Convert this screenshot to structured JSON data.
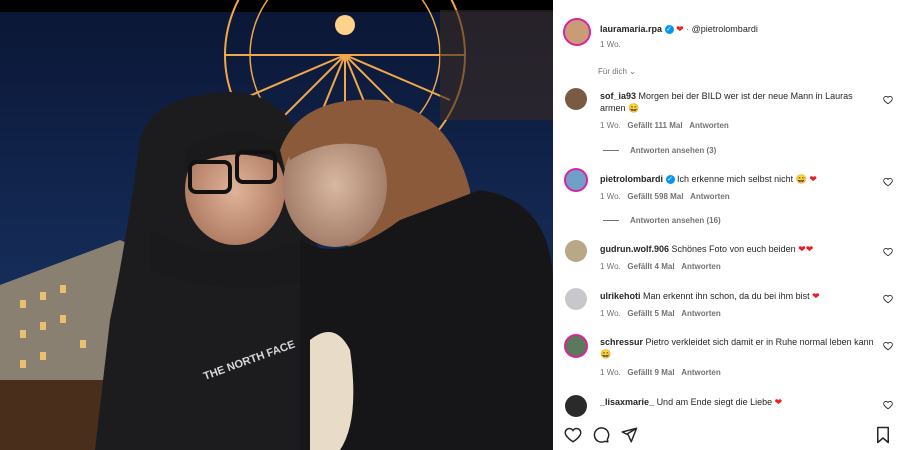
{
  "post": {
    "author": "lauramaria.rpa",
    "tag": "@pietrolombardi",
    "age": "1 Wo.",
    "for_you": "Für dich"
  },
  "photo": {
    "jacket_logo": "THE NORTH FACE"
  },
  "comments": [
    {
      "user": "sof_ia93",
      "text": "Morgen bei der BILD wer ist der neue Mann in Lauras armen 😄",
      "age": "1 Wo.",
      "likes": "Gefällt 111 Mal",
      "reply": "Antworten",
      "view_replies": "Antworten ansehen (3)"
    },
    {
      "user": "pietrolombardi",
      "verified": true,
      "text": "Ich erkenne mich selbst nicht 😄",
      "age": "1 Wo.",
      "likes": "Gefällt 598 Mal",
      "reply": "Antworten",
      "view_replies": "Antworten ansehen (16)"
    },
    {
      "user": "gudrun.wolf.906",
      "text": "Schönes Foto von euch beiden",
      "age": "1 Wo.",
      "likes": "Gefällt 4 Mal",
      "reply": "Antworten"
    },
    {
      "user": "ulrikehoti",
      "text": "Man erkennt ihn schon, da du bei ihm bist",
      "age": "1 Wo.",
      "likes": "Gefällt 5 Mal",
      "reply": "Antworten"
    },
    {
      "user": "schressur",
      "text": "Pietro verkleidet sich damit er in Ruhe normal leben kann 😄",
      "age": "1 Wo.",
      "likes": "Gefällt 9 Mal",
      "reply": "Antworten"
    },
    {
      "user": "_lisaxmarie_",
      "text": "Und am Ende siegt die Liebe"
    }
  ],
  "actions": {
    "like_icon": "heart-icon",
    "comment_icon": "comment-icon",
    "share_icon": "share-icon",
    "save_icon": "bookmark-icon"
  },
  "colors": {
    "verified": "#0095f6",
    "heart": "#ed1c24",
    "story_ring": "#d6249f"
  }
}
